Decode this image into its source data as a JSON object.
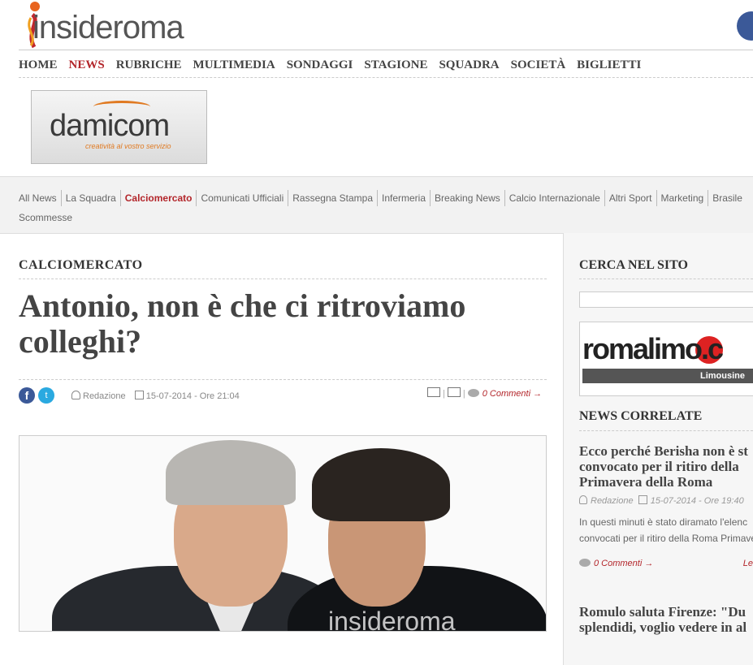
{
  "header": {
    "logo_text": "insideroma",
    "nav": [
      "HOME",
      "NEWS",
      "RUBRICHE",
      "MULTIMEDIA",
      "SONDAGGI",
      "STAGIONE",
      "SQUADRA",
      "SOCIETÀ",
      "BIGLIETTI"
    ],
    "nav_active": "NEWS"
  },
  "ads": {
    "damicom_word": "damicom",
    "damicom_tagline": "creatività al vostro servizio",
    "romalimo_word": "romalimo.c",
    "romalimo_sub": "Limousine"
  },
  "subnav": {
    "items": [
      "All News",
      "La Squadra",
      "Calciomercato",
      "Comunicati Ufficiali",
      "Rassegna Stampa",
      "Infermeria",
      "Breaking News",
      "Calcio Internazionale",
      "Altri Sport",
      "Marketing",
      "Brasile",
      "Scommesse"
    ],
    "active": "Calciomercato"
  },
  "article": {
    "category": "CALCIOMERCATO",
    "title": "Antonio, non è che ci ritroviamo colleghi?",
    "author": "Redazione",
    "date": "15-07-2014 - Ore 21:04",
    "comments": "0 Commenti →",
    "photo_watermark": "insideroma"
  },
  "sidebar": {
    "search_title": "CERCA NEL SITO",
    "search_value": "",
    "news_title": "NEWS CORRELATE",
    "news": [
      {
        "title_lines": [
          "Ecco perché Berisha non è st",
          "convocato per il ritiro della",
          "Primavera della Roma"
        ],
        "author": "Redazione",
        "date": "15-07-2014 - Ore 19:40",
        "excerpt_lines": [
          "In questi minuti è stato diramato l'elenc",
          "convocati per il ritiro della Roma Primave"
        ],
        "comments": "0 Commenti →",
        "more": "Le"
      },
      {
        "title_lines": [
          "Romulo saluta Firenze: \"Du",
          "splendidi, voglio vedere in al"
        ]
      }
    ]
  }
}
